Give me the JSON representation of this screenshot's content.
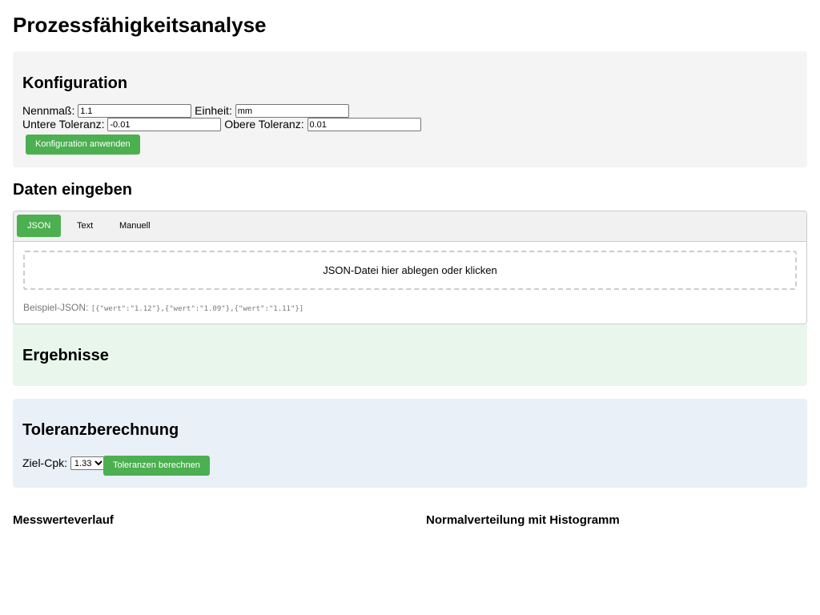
{
  "page": {
    "title": "Prozessfähigkeitsanalyse"
  },
  "config": {
    "title": "Konfiguration",
    "nennmass_label": "Nennmaß:",
    "nennmass_value": "1.1",
    "einheit_label": "Einheit:",
    "einheit_value": "mm",
    "untere_label": "Untere Toleranz:",
    "untere_value": "-0.01",
    "obere_label": "Obere Toleranz:",
    "obere_value": "0.01",
    "apply_button": "Konfiguration anwenden"
  },
  "data_input": {
    "title": "Daten eingeben",
    "tabs": [
      {
        "label": "JSON",
        "active": true
      },
      {
        "label": "Text",
        "active": false
      },
      {
        "label": "Manuell",
        "active": false
      }
    ],
    "dropzone_text": "JSON-Datei hier ablegen oder klicken",
    "example_label": "Beispiel-JSON:",
    "example_code": "[{\"wert\":\"1.12\"},{\"wert\":\"1.09\"},{\"wert\":\"1.11\"}]"
  },
  "results": {
    "title": "Ergebnisse"
  },
  "tolerance": {
    "title": "Toleranzberechnung",
    "cpk_label": "Ziel-Cpk:",
    "cpk_selected": "1.33",
    "calc_button": "Toleranzen berechnen"
  },
  "charts": {
    "trend_title": "Messwerteverlauf",
    "normal_title": "Normalverteilung mit Histogramm"
  },
  "colors": {
    "accent": "#4caf50",
    "config_bg": "#f4f4f4",
    "results_bg": "#e9f6ec",
    "tolerance_bg": "#e9f0f7"
  }
}
